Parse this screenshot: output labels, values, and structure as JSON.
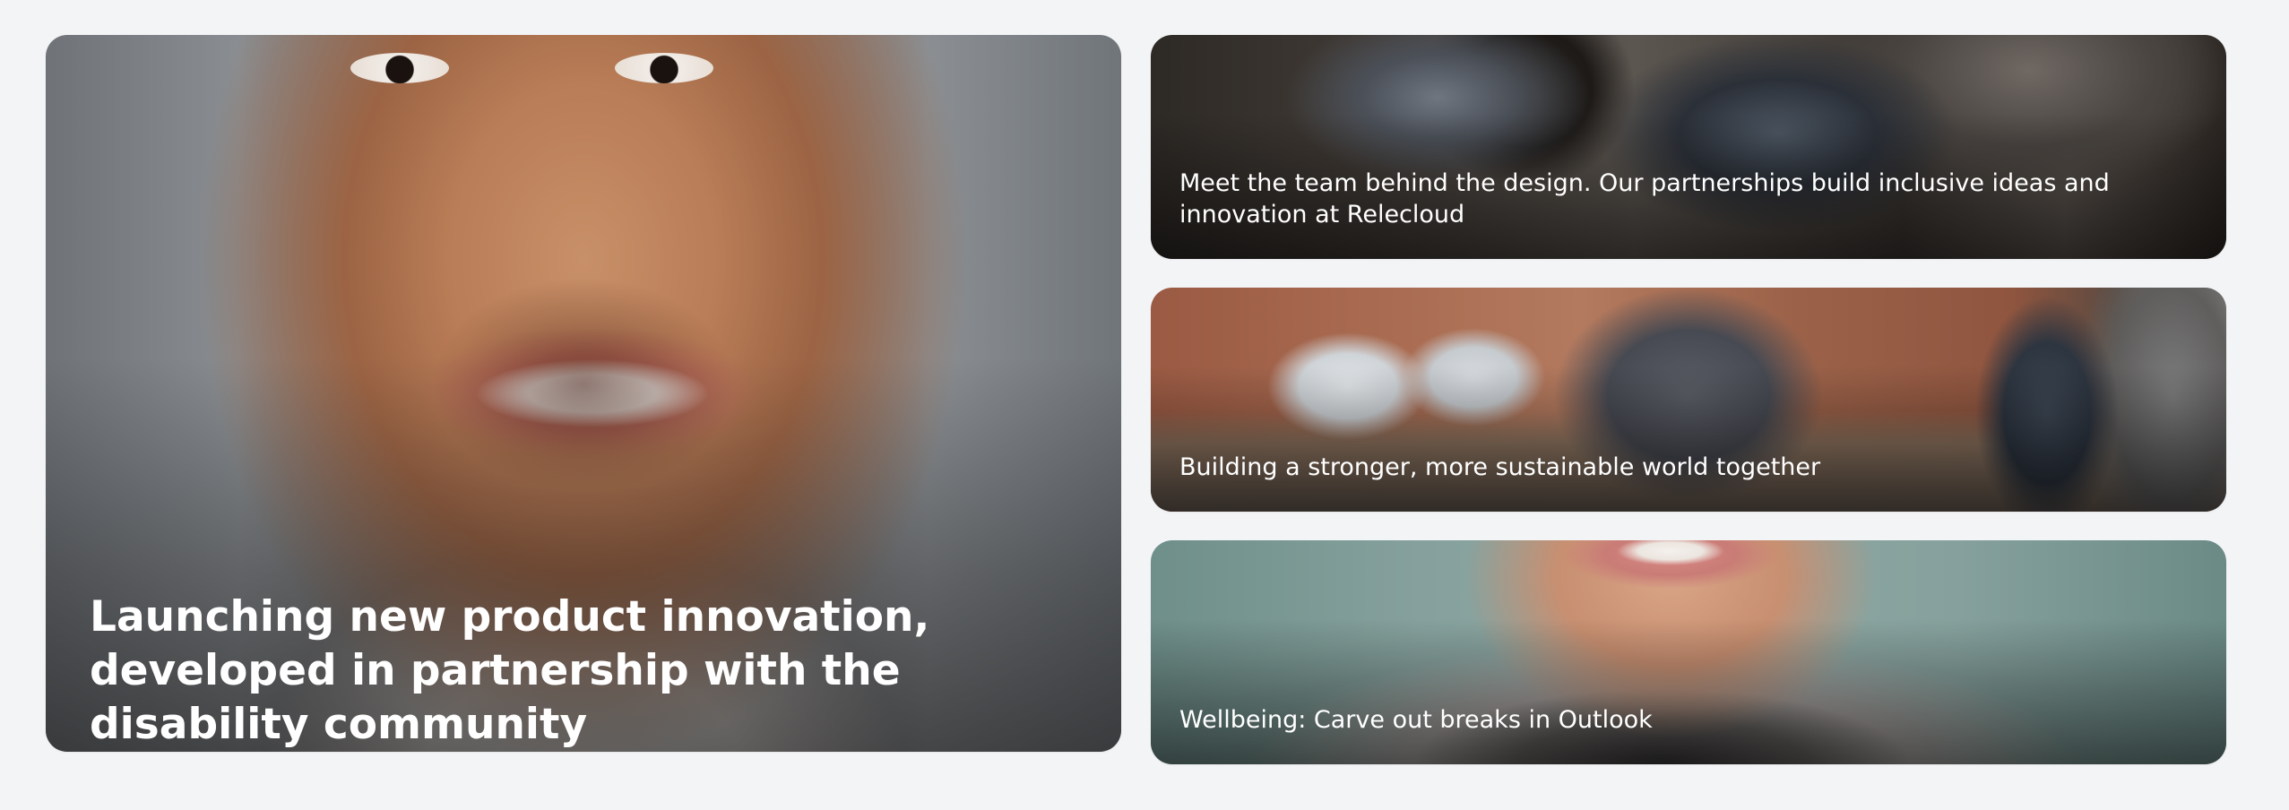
{
  "stories": [
    {
      "title": "Launching new product innovation, developed in partnership with the disability community",
      "image": "smiling-man-portrait"
    },
    {
      "title": "Meet the team behind the design. Our partnerships build inclusive ideas and innovation at Relecloud",
      "image": "team-working-on-laptops"
    },
    {
      "title": "Building a stronger, more sustainable world together",
      "image": "open-plan-brick-office"
    },
    {
      "title": "Wellbeing: Carve out breaks in Outlook",
      "image": "smiling-woman-closeup"
    }
  ]
}
